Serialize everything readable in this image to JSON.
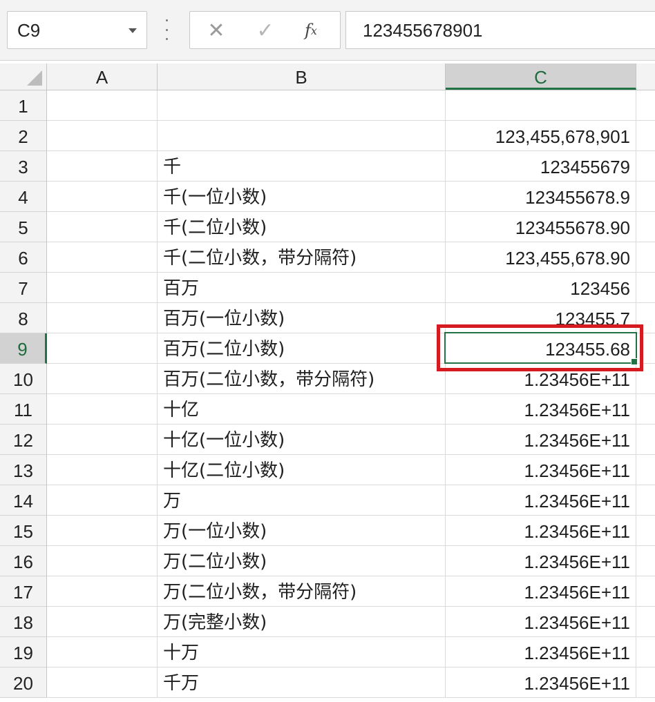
{
  "name_box": {
    "value": "C9"
  },
  "formula_bar": {
    "cancel_glyph": "✕",
    "enter_glyph": "✓",
    "fx_label": "f",
    "fx_sub": "x",
    "value": "123455678901"
  },
  "columns": [
    "A",
    "B",
    "C"
  ],
  "rows": [
    {
      "num": "1",
      "b": "",
      "c": ""
    },
    {
      "num": "2",
      "b": "",
      "c": "123,455,678,901"
    },
    {
      "num": "3",
      "b": "千",
      "c": "123455679"
    },
    {
      "num": "4",
      "b": "千(一位小数)",
      "c": "123455678.9"
    },
    {
      "num": "5",
      "b": "千(二位小数)",
      "c": "123455678.90"
    },
    {
      "num": "6",
      "b": "千(二位小数，带分隔符)",
      "c": "123,455,678.90"
    },
    {
      "num": "7",
      "b": "百万",
      "c": "123456"
    },
    {
      "num": "8",
      "b": "百万(一位小数)",
      "c": "123455.7"
    },
    {
      "num": "9",
      "b": "百万(二位小数)",
      "c": "123455.68"
    },
    {
      "num": "10",
      "b": "百万(二位小数，带分隔符)",
      "c": "1.23456E+11"
    },
    {
      "num": "11",
      "b": "十亿",
      "c": "1.23456E+11"
    },
    {
      "num": "12",
      "b": "十亿(一位小数)",
      "c": "1.23456E+11"
    },
    {
      "num": "13",
      "b": "十亿(二位小数)",
      "c": "1.23456E+11"
    },
    {
      "num": "14",
      "b": "万",
      "c": "1.23456E+11"
    },
    {
      "num": "15",
      "b": "万(一位小数)",
      "c": "1.23456E+11"
    },
    {
      "num": "16",
      "b": "万(二位小数)",
      "c": "1.23456E+11"
    },
    {
      "num": "17",
      "b": "万(二位小数，带分隔符)",
      "c": "1.23456E+11"
    },
    {
      "num": "18",
      "b": "万(完整小数)",
      "c": "1.23456E+11"
    },
    {
      "num": "19",
      "b": "十万",
      "c": "1.23456E+11"
    },
    {
      "num": "20",
      "b": "千万",
      "c": "1.23456E+11"
    }
  ],
  "selection": {
    "cell": "C9",
    "row": 9,
    "accent": "#217346",
    "highlight": "#d71920"
  }
}
